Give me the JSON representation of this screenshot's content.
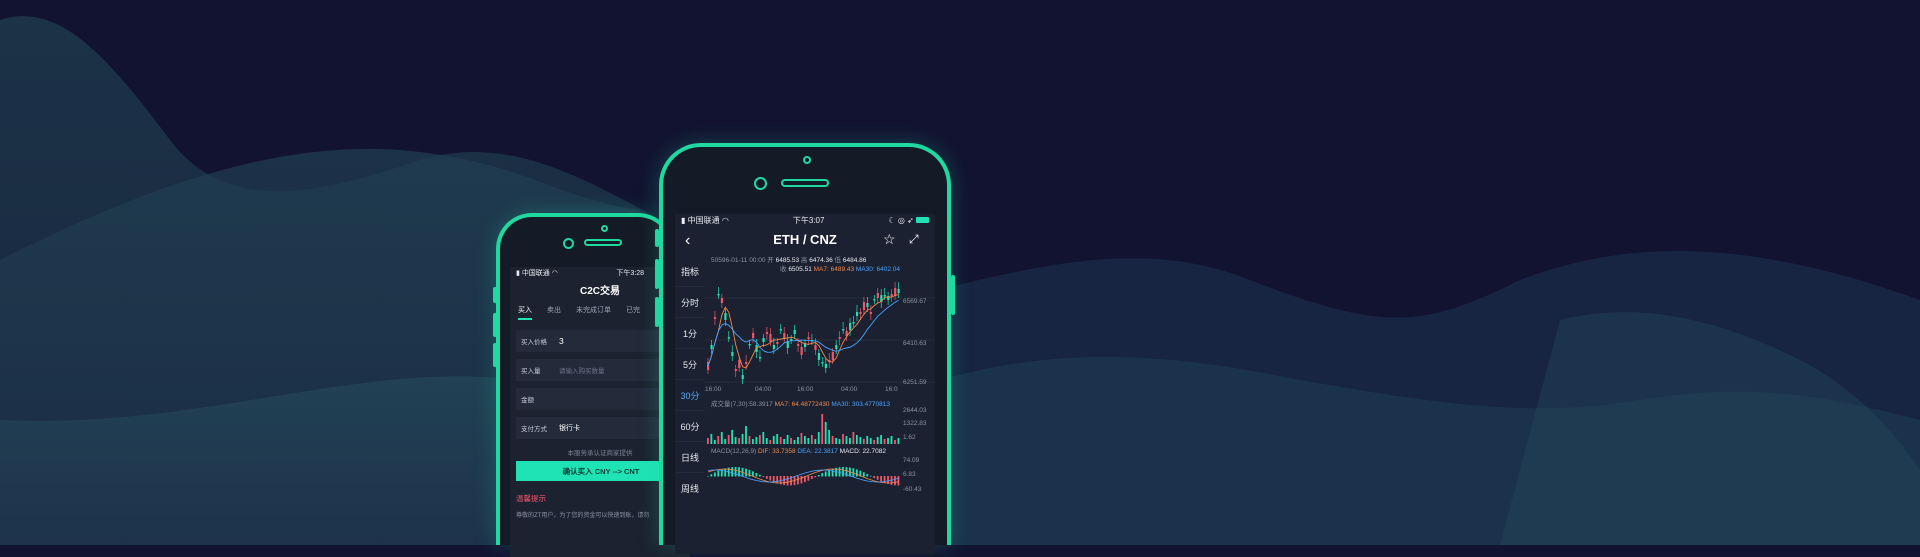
{
  "left_phone": {
    "status": {
      "carrier": "中国联通",
      "time": "下午3:28"
    },
    "title": "C2C交易",
    "tabs": [
      {
        "label": "买入",
        "active": true
      },
      {
        "label": "卖出",
        "active": false
      },
      {
        "label": "未完成订单",
        "active": false
      },
      {
        "label": "已完",
        "active": false
      }
    ],
    "form": {
      "price_label": "买入价格",
      "price_value": "3",
      "amount_label": "买入量",
      "amount_placeholder": "请输入购买数量",
      "total_label": "金额",
      "pay_label": "支付方式",
      "pay_value": "银行卡"
    },
    "note": "本服务承认证商家提供",
    "confirm_button": "确认买入 CNY --> CNT",
    "warning_title": "温馨提示",
    "warning_text": "尊敬的ZT用户，为了您的资金可以快速到账，请勿"
  },
  "right_phone": {
    "status": {
      "carrier": "中国联通",
      "time": "下午3:07"
    },
    "pair": "ETH / CNZ",
    "side_tabs": [
      {
        "label": "指标",
        "active": false
      },
      {
        "label": "分时",
        "active": false
      },
      {
        "label": "1分",
        "active": false
      },
      {
        "label": "5分",
        "active": false
      },
      {
        "label": "30分",
        "active": true
      },
      {
        "label": "60分",
        "active": false
      },
      {
        "label": "日线",
        "active": false
      },
      {
        "label": "周线",
        "active": false
      }
    ],
    "ohlc": {
      "date": "50596-01-11 00:00",
      "open_label": "开",
      "open": "6485.53",
      "high_label": "高",
      "high": "6474.36",
      "low_label": "低",
      "low": "6484.86",
      "close_label": "收",
      "close": "6505.51",
      "ma7_label": "MA7:",
      "ma7": "6489.43",
      "ma30_label": "MA30:",
      "ma30": "6402.04"
    },
    "price_axis": [
      "6569.67",
      "6410.63",
      "6251.59"
    ],
    "time_axis": [
      "16:00",
      "04:00",
      "16:00",
      "04:00",
      "16:0"
    ],
    "volume": {
      "label": "成交量(7,30):58.3917",
      "ma7_label": "MA7:",
      "ma7": "64.48772430",
      "ma30_label": "MA30:",
      "ma30": "303.4770813",
      "axis": [
        "2644.03",
        "1322.83",
        "1.62"
      ]
    },
    "macd": {
      "label": "MACD(12,26,9)",
      "dif_label": "DIF:",
      "dif": "33.7358",
      "dea_label": "DEA:",
      "dea": "22.3817",
      "macd_label": "MACD:",
      "macd": "22.7082",
      "axis": [
        "74.09",
        "6.83",
        "-60.43"
      ]
    }
  },
  "colors": {
    "accent": "#1fd9a1",
    "up": "#1fe3b4",
    "down": "#f0556a",
    "ma7": "#f08a4b",
    "ma30": "#4aa3ff",
    "active_tab": "#5aa8ff"
  },
  "icons": [
    "wifi-icon",
    "back-arrow-icon",
    "star-icon",
    "expand-icon",
    "battery-icon"
  ]
}
